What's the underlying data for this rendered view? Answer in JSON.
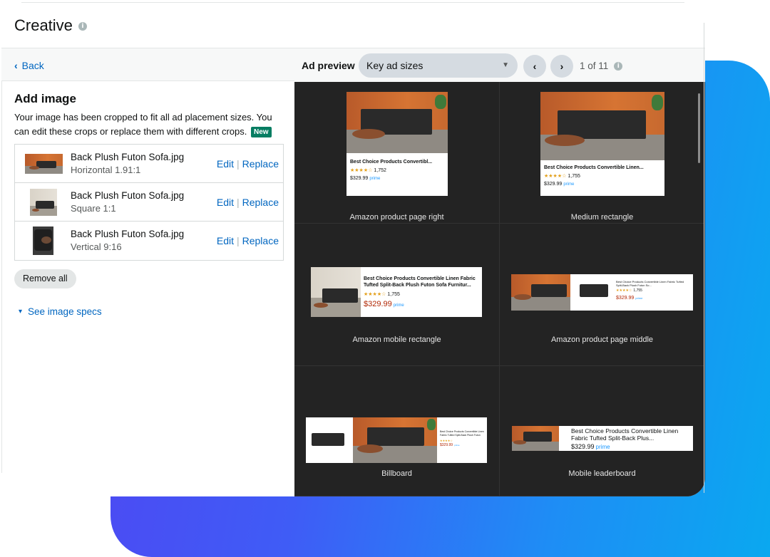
{
  "creative": {
    "title": "Creative"
  },
  "left": {
    "back_label": "Back",
    "add_image_title": "Add image",
    "description": "Your image has been cropped to fit all ad placement sizes. You can edit these crops or replace them with different crops.",
    "new_badge": "New",
    "files": [
      {
        "name": "Back Plush Futon Sofa.jpg",
        "crop": "Horizontal 1.91:1",
        "edit": "Edit",
        "replace": "Replace"
      },
      {
        "name": "Back Plush Futon Sofa.jpg",
        "crop": "Square 1:1",
        "edit": "Edit",
        "replace": "Replace"
      },
      {
        "name": "Back Plush Futon Sofa.jpg",
        "crop": "Vertical 9:16",
        "edit": "Edit",
        "replace": "Replace"
      }
    ],
    "remove_all": "Remove all",
    "image_specs": "See image specs"
  },
  "preview": {
    "label": "Ad preview",
    "dropdown_value": "Key ad sizes",
    "pager": "1 of 11",
    "placements": [
      "Amazon product page right",
      "Medium rectangle",
      "Amazon mobile rectangle",
      "Amazon product page middle",
      "Billboard",
      "Mobile leaderboard"
    ],
    "ads": {
      "product_page_right": {
        "title": "Best Choice Products Convertibl...",
        "reviews": "1,752",
        "price": "$329.99"
      },
      "medium_rectangle": {
        "title": "Best Choice Products Convertible Linen...",
        "reviews": "1,755",
        "price": "$329.99"
      },
      "mobile_rectangle": {
        "title": "Best Choice Products Convertible Linen Fabric Tufted Split-Back Plush Futon Sofa Furnitur...",
        "reviews": "1,755",
        "price": "$329.99"
      },
      "product_page_middle": {
        "title": "Best Choice Products Convertible Linen Fabric Tufted Split-Back Plush Futon So...",
        "reviews": "1,755",
        "price": "$329.99"
      },
      "billboard": {
        "title": "Best Choice Products Convertible Linen Fabric Tufted Split-Back Plush Futon",
        "price": "$329.99"
      },
      "mobile_leaderboard": {
        "title": "Best Choice Products Convertible Linen Fabric Tufted Split-Back Plus...",
        "price": "$329.99"
      }
    },
    "prime_label": "prime"
  },
  "colors": {
    "link": "#0066c0",
    "badge_green": "#067d62",
    "dark_bg": "#232323",
    "gradient_start": "#4f46f2",
    "gradient_end": "#0aa8f0"
  }
}
